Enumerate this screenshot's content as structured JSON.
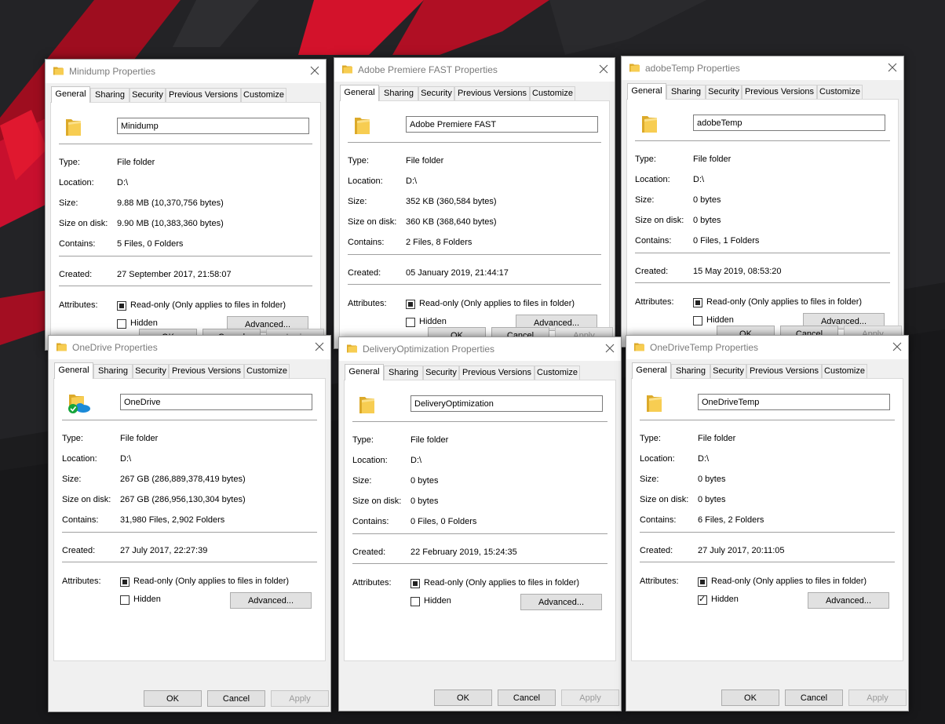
{
  "labels": {
    "type": "Type:",
    "location": "Location:",
    "size": "Size:",
    "size_on_disk": "Size on disk:",
    "contains": "Contains:",
    "created": "Created:",
    "attributes": "Attributes:",
    "readonly": "Read-only (Only applies to files in folder)",
    "hidden": "Hidden",
    "advanced": "Advanced..."
  },
  "tabs": [
    "General",
    "Sharing",
    "Security",
    "Previous Versions",
    "Customize"
  ],
  "buttons": {
    "ok": "OK",
    "cancel": "Cancel",
    "apply": "Apply"
  },
  "windows": [
    {
      "title": "Minidump Properties",
      "icon": "folder-icon",
      "name": "Minidump",
      "type": "File folder",
      "location": "D:\\",
      "size": "9.88 MB (10,370,756 bytes)",
      "size_on_disk": "9.90 MB (10,383,360 bytes)",
      "contains": "5 Files, 0 Folders",
      "created": "27 September 2017, 21:58:07",
      "readonly_state": "indeterminate",
      "hidden_checked": false
    },
    {
      "title": "Adobe Premiere FAST Properties",
      "icon": "folder-icon",
      "name": "Adobe Premiere FAST",
      "type": "File folder",
      "location": "D:\\",
      "size": "352 KB (360,584 bytes)",
      "size_on_disk": "360 KB (368,640 bytes)",
      "contains": "2 Files, 8 Folders",
      "created": "05 January 2019, 21:44:17",
      "readonly_state": "indeterminate",
      "hidden_checked": false
    },
    {
      "title": "adobeTemp Properties",
      "icon": "folder-icon",
      "name": "adobeTemp",
      "type": "File folder",
      "location": "D:\\",
      "size": "0 bytes",
      "size_on_disk": "0 bytes",
      "contains": "0 Files, 1 Folders",
      "created": "15 May 2019, 08:53:20",
      "readonly_state": "indeterminate",
      "hidden_checked": false
    },
    {
      "title": "OneDrive Properties",
      "icon": "onedrive-folder-icon",
      "name": "OneDrive",
      "type": "File folder",
      "location": "D:\\",
      "size": "267 GB (286,889,378,419 bytes)",
      "size_on_disk": "267 GB (286,956,130,304 bytes)",
      "contains": "31,980 Files, 2,902 Folders",
      "created": "27 July 2017, 22:27:39",
      "readonly_state": "indeterminate",
      "hidden_checked": false
    },
    {
      "title": "DeliveryOptimization Properties",
      "icon": "folder-icon",
      "name": "DeliveryOptimization",
      "type": "File folder",
      "location": "D:\\",
      "size": "0 bytes",
      "size_on_disk": "0 bytes",
      "contains": "0 Files, 0 Folders",
      "created": "22 February 2019, 15:24:35",
      "readonly_state": "indeterminate",
      "hidden_checked": false
    },
    {
      "title": "OneDriveTemp Properties",
      "icon": "folder-icon",
      "name": "OneDriveTemp",
      "type": "File folder",
      "location": "D:\\",
      "size": "0 bytes",
      "size_on_disk": "0 bytes",
      "contains": "6 Files, 2 Folders",
      "created": "27 July 2017, 20:11:05",
      "readonly_state": "indeterminate",
      "hidden_checked": true
    }
  ],
  "colors": {
    "background": "#1d1d1f",
    "accent_red": "#c8102e",
    "folder_yellow": "#f5c842",
    "window_bg": "#f0f0f0"
  }
}
